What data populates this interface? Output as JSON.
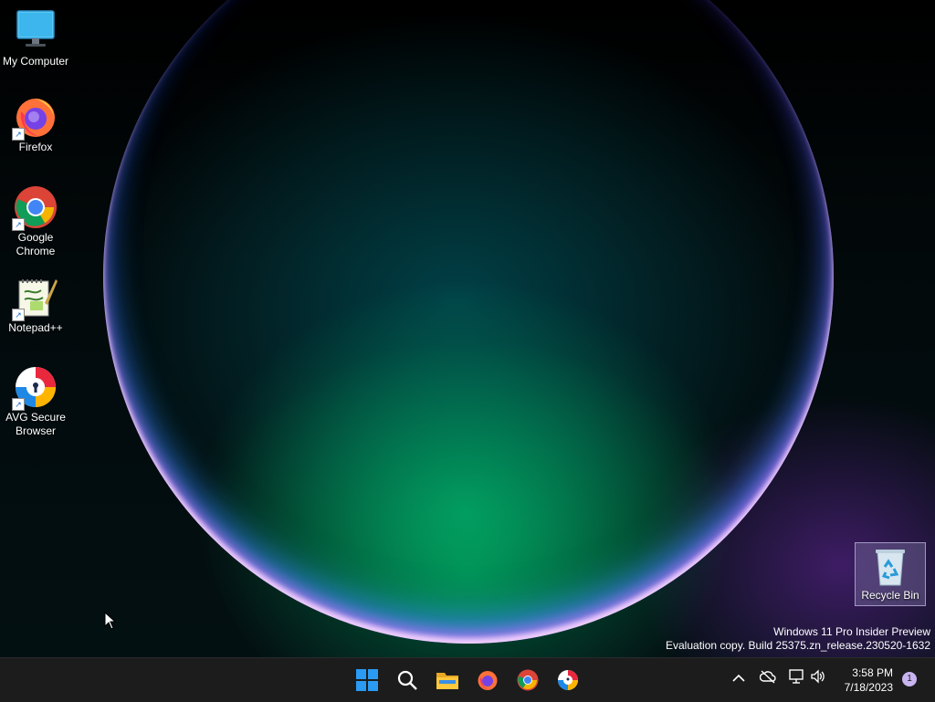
{
  "desktop": {
    "icons": [
      {
        "label": "My Computer",
        "icon": "monitor-icon"
      },
      {
        "label": "Firefox",
        "icon": "firefox-icon"
      },
      {
        "label": "Google Chrome",
        "icon": "chrome-icon"
      },
      {
        "label": "Notepad++",
        "icon": "notepadpp-icon"
      },
      {
        "label": "AVG Secure Browser",
        "icon": "avg-browser-icon"
      },
      {
        "label": "Recycle Bin",
        "icon": "recycle-bin-icon"
      }
    ],
    "shortcut_glyph": "↗",
    "watermark": {
      "line1": "Windows 11 Pro Insider Preview",
      "line2": "Evaluation copy. Build 25375.zn_release.230520-1632"
    }
  },
  "taskbar": {
    "pinned": [
      "start-icon",
      "search-icon",
      "file-explorer-icon",
      "firefox-icon",
      "chrome-icon",
      "avg-browser-icon"
    ],
    "tray": {
      "overflow_glyph": "^",
      "time": "3:58 PM",
      "date": "7/18/2023",
      "notification_count": "1"
    }
  },
  "colors": {
    "taskbar_bg": "#1c1c1c",
    "start_blue": "#2b9af3",
    "notif_badge": "#c8b4f0"
  }
}
